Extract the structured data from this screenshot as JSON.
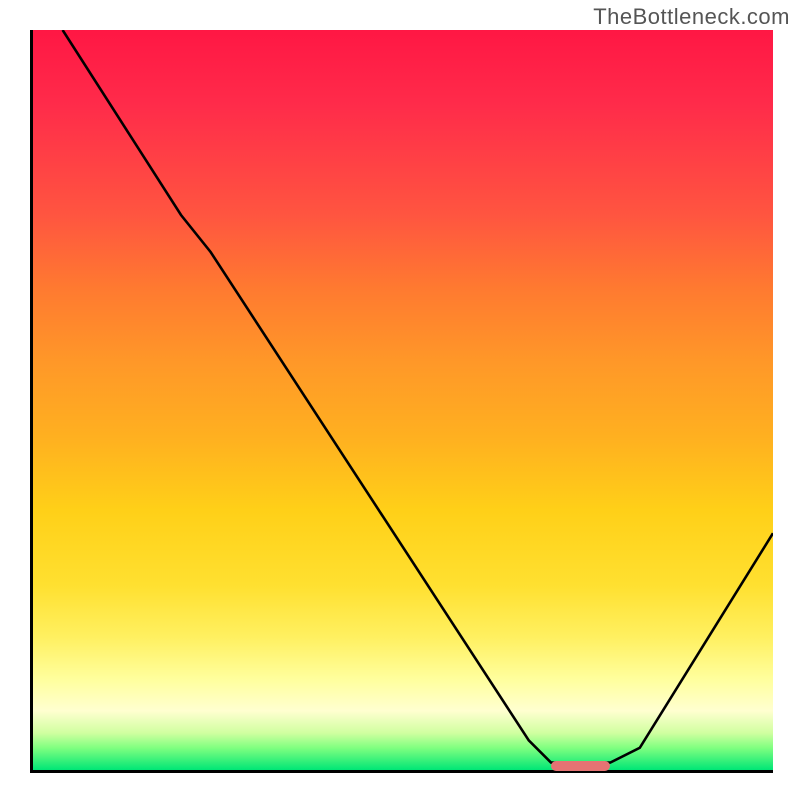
{
  "watermark": "TheBottleneck.com",
  "chart_data": {
    "type": "line",
    "title": "",
    "xlabel": "",
    "ylabel": "",
    "xlim": [
      0,
      100
    ],
    "ylim": [
      0,
      100
    ],
    "curve": [
      {
        "x": 4,
        "y": 100
      },
      {
        "x": 20,
        "y": 75
      },
      {
        "x": 24,
        "y": 70
      },
      {
        "x": 67,
        "y": 4
      },
      {
        "x": 70,
        "y": 1
      },
      {
        "x": 78,
        "y": 1
      },
      {
        "x": 82,
        "y": 3
      },
      {
        "x": 100,
        "y": 32
      }
    ],
    "marker": {
      "x_start": 70,
      "x_end": 78,
      "y": 0.5,
      "color": "#e57373"
    },
    "gradient": {
      "top": "#ff1744",
      "mid": "#ffc107",
      "bottom": "#00e676"
    }
  }
}
